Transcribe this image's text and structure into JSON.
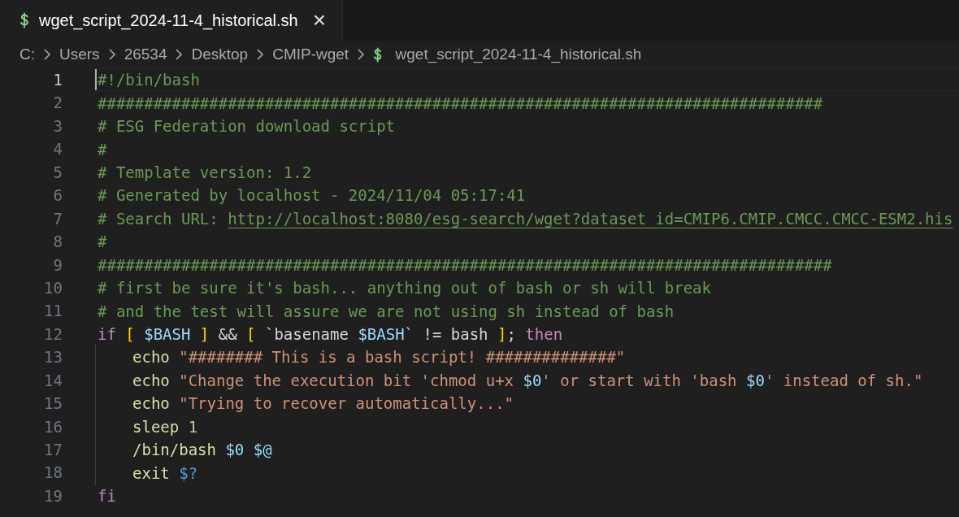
{
  "tabs": [
    {
      "label": "wget_script_2024-11-4_historical.sh",
      "selected": true,
      "close": "×"
    }
  ],
  "breadcrumbs": [
    {
      "label": "C:",
      "kind": "folder"
    },
    {
      "label": "Users",
      "kind": "folder"
    },
    {
      "label": "26534",
      "kind": "folder"
    },
    {
      "label": "Desktop",
      "kind": "folder"
    },
    {
      "label": "CMIP-wget",
      "kind": "folder"
    },
    {
      "label": "wget_script_2024-11-4_historical.sh",
      "kind": "file"
    }
  ],
  "editor": {
    "lines": [
      {
        "number": "1",
        "active": true,
        "tokens": [
          {
            "kind": "comment",
            "text": "#!/bin/bash"
          }
        ]
      },
      {
        "number": "2",
        "active": false,
        "tokens": [
          {
            "kind": "comment",
            "text": "##############################################################################"
          }
        ]
      },
      {
        "number": "3",
        "active": false,
        "tokens": [
          {
            "kind": "comment",
            "text": "# ESG Federation download script"
          }
        ]
      },
      {
        "number": "4",
        "active": false,
        "tokens": [
          {
            "kind": "comment",
            "text": "#"
          }
        ]
      },
      {
        "number": "5",
        "active": false,
        "tokens": [
          {
            "kind": "comment",
            "text": "# Template version: 1.2"
          }
        ]
      },
      {
        "number": "6",
        "active": false,
        "tokens": [
          {
            "kind": "comment",
            "text": "# Generated by localhost - 2024/11/04 05:17:41"
          }
        ]
      },
      {
        "number": "7",
        "active": false,
        "tokens": [
          {
            "kind": "comment",
            "text": "# Search URL: "
          },
          {
            "kind": "link",
            "text": "http://localhost:8080/esg-search/wget?dataset_id=CMIP6.CMIP.CMCC.CMCC-ESM2.his"
          }
        ]
      },
      {
        "number": "8",
        "active": false,
        "tokens": [
          {
            "kind": "comment",
            "text": "#"
          }
        ]
      },
      {
        "number": "9",
        "active": false,
        "tokens": [
          {
            "kind": "comment",
            "text": "###############################################################################"
          }
        ]
      },
      {
        "number": "10",
        "active": false,
        "tokens": [
          {
            "kind": "comment",
            "text": "# first be sure it's bash... anything out of bash or sh will break"
          }
        ]
      },
      {
        "number": "11",
        "active": false,
        "tokens": [
          {
            "kind": "comment",
            "text": "# and the test will assure we are not using sh instead of bash"
          }
        ]
      },
      {
        "number": "12",
        "active": false,
        "tokens": [
          {
            "kind": "keyword",
            "text": "if "
          },
          {
            "kind": "bracket",
            "text": "["
          },
          {
            "kind": "variable",
            "text": " $BASH "
          },
          {
            "kind": "bracket",
            "text": "]"
          },
          {
            "kind": "plain",
            "text": " && "
          },
          {
            "kind": "bracket",
            "text": "["
          },
          {
            "kind": "plain",
            "text": " `basename "
          },
          {
            "kind": "variable",
            "text": "$BASH"
          },
          {
            "kind": "plain",
            "text": "` != bash "
          },
          {
            "kind": "bracket",
            "text": "]"
          },
          {
            "kind": "plain",
            "text": "; "
          },
          {
            "kind": "keyword",
            "text": "then"
          }
        ]
      },
      {
        "number": "13",
        "active": false,
        "indented": true,
        "tokens": [
          {
            "kind": "command",
            "text": "echo "
          },
          {
            "kind": "string",
            "text": "\"######## This is a bash script! ##############\""
          }
        ]
      },
      {
        "number": "14",
        "active": false,
        "indented": true,
        "tokens": [
          {
            "kind": "command",
            "text": "echo "
          },
          {
            "kind": "string",
            "text": "\"Change the execution bit 'chmod u+x "
          },
          {
            "kind": "variable",
            "text": "$0"
          },
          {
            "kind": "string",
            "text": "' or start with 'bash "
          },
          {
            "kind": "variable",
            "text": "$0"
          },
          {
            "kind": "string",
            "text": "' instead of sh.\""
          }
        ]
      },
      {
        "number": "15",
        "active": false,
        "indented": true,
        "tokens": [
          {
            "kind": "command",
            "text": "echo "
          },
          {
            "kind": "string",
            "text": "\"Trying to recover automatically...\""
          }
        ]
      },
      {
        "number": "16",
        "active": false,
        "indented": true,
        "tokens": [
          {
            "kind": "command",
            "text": "sleep "
          },
          {
            "kind": "number",
            "text": "1"
          }
        ]
      },
      {
        "number": "17",
        "active": false,
        "indented": true,
        "tokens": [
          {
            "kind": "command",
            "text": "/bin/bash "
          },
          {
            "kind": "variable",
            "text": "$0 $@"
          }
        ]
      },
      {
        "number": "18",
        "active": false,
        "indented": true,
        "tokens": [
          {
            "kind": "command",
            "text": "exit "
          },
          {
            "kind": "special",
            "text": "$?"
          }
        ]
      },
      {
        "number": "19",
        "active": false,
        "tokens": [
          {
            "kind": "keyword",
            "text": "fi"
          }
        ]
      }
    ]
  }
}
